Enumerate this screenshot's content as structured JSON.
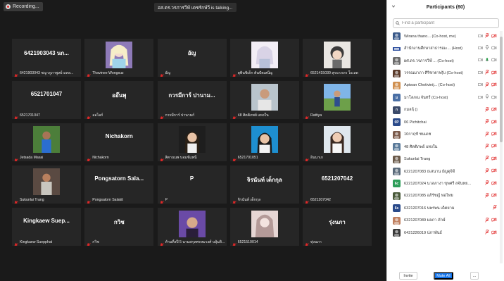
{
  "recording": {
    "label": "Recording..."
  },
  "talking_banner": "อส.ดร.วรภารวีฟ์ เดชรักษ์วี is talking...",
  "tiles": [
    {
      "name": "6421903043 นก...",
      "label": "6421903043 ชญาภูภาพูลย์ มหล...",
      "kind": "text"
    },
    {
      "name": "",
      "label": "Thavinee Wongsuz",
      "kind": "photo",
      "photo": "elsa"
    },
    {
      "name": "อัญ",
      "label": "อัญ",
      "kind": "text"
    },
    {
      "name": "",
      "label": "ยุพินชิเด็ก ต้นปัตเสนีญ",
      "kind": "photo",
      "photo": "anime"
    },
    {
      "name": "",
      "label": "6521415030 สุรนาภภร โอเลด",
      "kind": "photo",
      "photo": "doll"
    },
    {
      "name": "6521701047",
      "label": "6521701047",
      "kind": "text"
    },
    {
      "name": "ออ๊นพุ",
      "label": "ออไลก์",
      "kind": "text"
    },
    {
      "name": "กวรมีการ์ ปานาม...",
      "label": "กวรมีการ์ ปานามก์",
      "kind": "text"
    },
    {
      "name": "",
      "label": "48 ศิตติภพย์ แทงใน",
      "kind": "photo",
      "photo": "man"
    },
    {
      "name": "",
      "label": "Rattiya",
      "kind": "photo",
      "photo": "outdoor"
    },
    {
      "name": "",
      "label": "Jetsada Masai",
      "kind": "photo",
      "photo": "field"
    },
    {
      "name": "Nichakorn",
      "label": "Nichakorn",
      "kind": "text"
    },
    {
      "name": "",
      "label": "สิตานนพ บอมช์แพนี",
      "kind": "photo",
      "photo": "woman"
    },
    {
      "name": "",
      "label": "6521701051",
      "kind": "photo",
      "photo": "bluegirl"
    },
    {
      "name": "",
      "label": "อินนาเก",
      "kind": "photo",
      "photo": "girl"
    },
    {
      "name": "",
      "label": "Sukunlai Trang",
      "kind": "photo",
      "photo": "boy"
    },
    {
      "name": "Pongsatorn Sala...",
      "label": "Pongsatorn Salakit",
      "kind": "text"
    },
    {
      "name": "P",
      "label": "P",
      "kind": "text"
    },
    {
      "name": "จิรนันท์ เด็กกุล",
      "label": "จิรนันท์ เด็กกุล",
      "kind": "text"
    },
    {
      "name": "6521207042",
      "label": "6521207042",
      "kind": "text"
    },
    {
      "name": "Kingkaew Suep...",
      "label": "Kingkaew Suepphat",
      "kind": "text"
    },
    {
      "name": "กวิช",
      "label": "กวิช",
      "kind": "text"
    },
    {
      "name": "",
      "label": "ห้ามทิ้งปี 5 นามสกุลพรหมวงศ์ บลุ้มสิ...",
      "kind": "photo",
      "photo": "purple"
    },
    {
      "name": "",
      "label": "6521510014",
      "kind": "photo",
      "photo": "sketch"
    },
    {
      "name": "รุ่งนภา",
      "label": "ทุ่งนภา",
      "kind": "text"
    }
  ],
  "participants": {
    "title": "Participants (60)",
    "search_placeholder": "Find a participant",
    "list": [
      {
        "name": "Wirana thano... (Co-host, me)",
        "avatar": "photo",
        "color": "#3a5a8a",
        "icons": [
          "video",
          "mic",
          "cam"
        ]
      },
      {
        "name": "สำนักงานศึกษาสาธารณะ... (Host)",
        "avatar": "logo",
        "color": "#ffffff",
        "icons": [
          "video",
          "mic-on",
          "cam-on"
        ]
      },
      {
        "name": "ผศ.ดร.วรภารวีฟ์ ... (Co-host)",
        "avatar": "photo",
        "color": "#6a6a6a",
        "icons": [
          "video",
          "mic-talk",
          "cam-on"
        ]
      },
      {
        "name": "วรรณมาภา ศิริชาตาพ(ับ (Co-host)",
        "avatar": "photo",
        "color": "#5a3a2a",
        "icons": [
          "video",
          "mic",
          "cam"
        ]
      },
      {
        "name": "Apiwan Chotivinij... (Co-host)",
        "avatar": "photo",
        "color": "#d09050",
        "icons": [
          "video",
          "mic",
          "cam"
        ]
      },
      {
        "name": "มาโลภณ จันทร์ (Co-host)",
        "avatar": "letter",
        "letter": "ม",
        "color": "#4a6fa5",
        "icons": [
          "video",
          "mic-on",
          "cam-on"
        ]
      },
      {
        "name": "กมลฤ์ ()",
        "avatar": "letter",
        "letter": "ก",
        "color": "#3a4a6a",
        "icons": [
          "mic",
          "cam"
        ]
      },
      {
        "name": "06 Pichitchai",
        "avatar": "letter",
        "letter": "0P",
        "color": "#2a4a8a",
        "icons": [
          "mic",
          "cam"
        ]
      },
      {
        "name": "10กาฤชั ชนเดช",
        "avatar": "photo",
        "color": "#7a5a4a",
        "icons": [
          "mic",
          "cam"
        ]
      },
      {
        "name": "48 ศิตติภพย์ แทงใน",
        "avatar": "photo",
        "color": "#5a7a9a",
        "icons": [
          "mic",
          "cam"
        ]
      },
      {
        "name": "Sukunlai Trang",
        "avatar": "photo",
        "color": "#6a5a4a",
        "icons": [
          "mic",
          "cam"
        ]
      },
      {
        "name": "6221207083 ธเสนาน ธัญดุจิจี",
        "avatar": "photo",
        "color": "#5a6a7a",
        "icons": [
          "mic",
          "cam"
        ]
      },
      {
        "name": "6221207024 นวลภางา ขุพศรี สจันทย...",
        "avatar": "letter",
        "letter": "6c",
        "color": "#2e9e5a",
        "icons": [
          "mic",
          "cam"
        ]
      },
      {
        "name": "6221207085 อภิรัชญ์ พ่อไทย",
        "avatar": "photo",
        "color": "#4a5a3a",
        "icons": [
          "mic",
          "cam"
        ]
      },
      {
        "name": "6321207016 นพรพน เด็ตยาม",
        "avatar": "letter",
        "letter": "6s",
        "color": "#2a4a8a",
        "icons": [
          "mic"
        ]
      },
      {
        "name": "6321207089 ผลภา ภักษ์",
        "avatar": "photo",
        "color": "#c08060",
        "icons": [
          "mic",
          "cam"
        ]
      },
      {
        "name": "6421226019 ปภาพันธ์",
        "avatar": "photo",
        "color": "#3a3a3a",
        "icons": [
          "mic",
          "cam"
        ]
      }
    ]
  },
  "footer": {
    "invite": "Invite",
    "mute_all": "Mute All",
    "more": "..."
  },
  "colors": {
    "accent": "#0e71eb",
    "muted_red": "#e02828",
    "panel_bg": "#ffffff",
    "video_bg": "#1a1a1a",
    "tile_bg": "#262626"
  }
}
